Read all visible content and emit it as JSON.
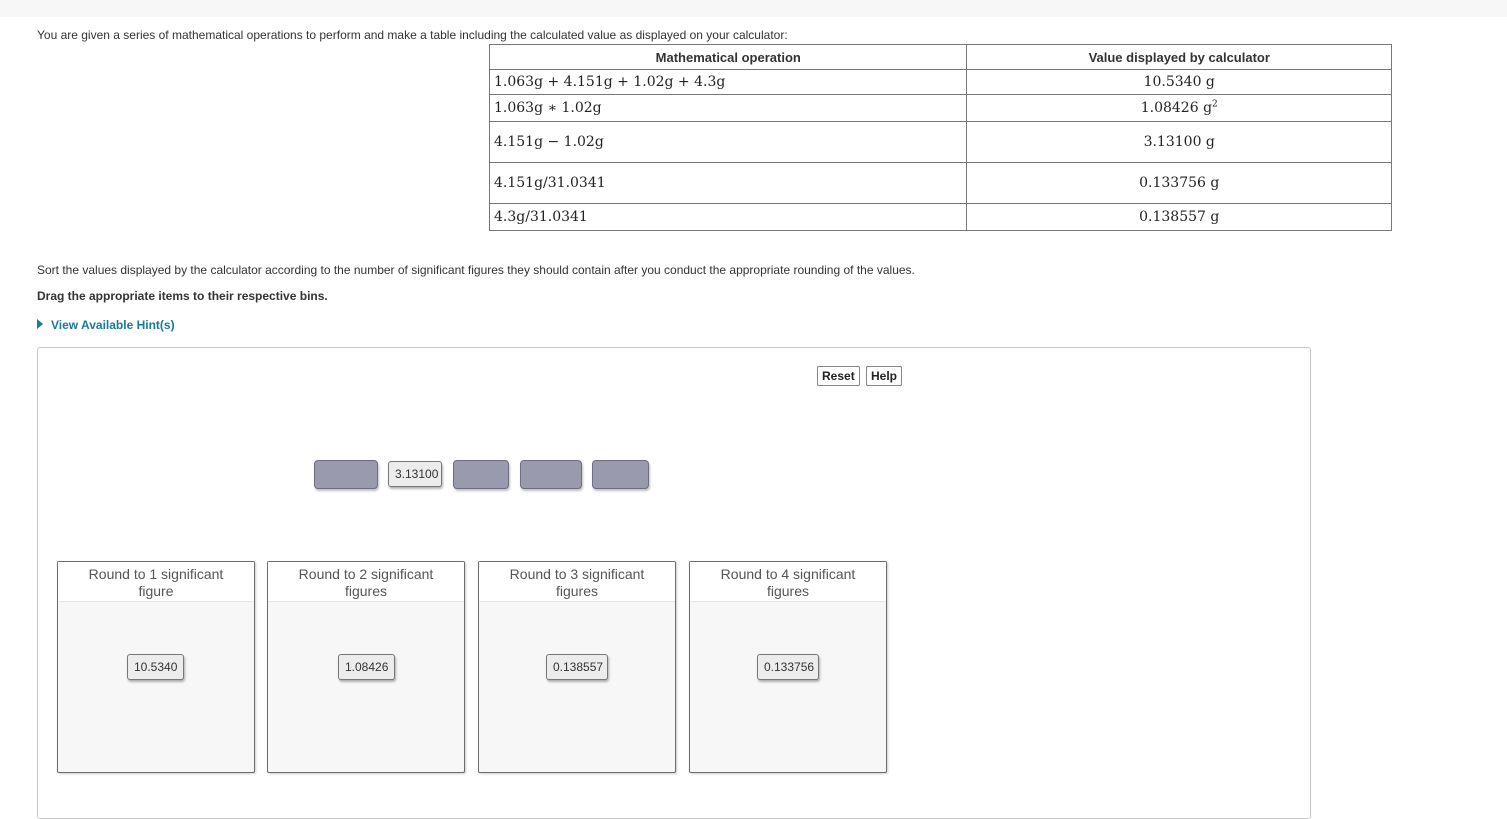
{
  "intro_text": "You are given a series of mathematical operations to perform and make a table including the calculated value as displayed on your calculator:",
  "table": {
    "headers": [
      "Mathematical operation",
      "Value displayed by calculator"
    ],
    "rows": [
      {
        "operation": "1.063g + 4.151g + 1.02g + 4.3g",
        "value": "10.5340 g"
      },
      {
        "operation": "1.063g ∗ 1.02g",
        "value": "1.08426 g",
        "value_sup": "2"
      },
      {
        "operation": "4.151g − 1.02g",
        "value": "3.13100 g"
      },
      {
        "operation": "4.151g/31.0341",
        "value": "0.133756 g"
      },
      {
        "operation": "4.3g/31.0341",
        "value": "0.138557 g"
      }
    ]
  },
  "sort_text": "Sort the values displayed by the calculator according to the number of significant figures they should contain after you conduct the appropriate rounding of the values.",
  "drag_text": "Drag the appropriate items to their respective bins.",
  "hint_label": "View Available Hint(s)",
  "buttons": {
    "reset": "Reset",
    "help": "Help"
  },
  "pool_item": "3.13100",
  "bins": [
    {
      "title": "Round to 1 significant figure",
      "item": "10.5340"
    },
    {
      "title": "Round to 2 significant figures",
      "item": "1.08426"
    },
    {
      "title": "Round to 3 significant figures",
      "item": "0.138557"
    },
    {
      "title": "Round to 4 significant figures",
      "item": "0.133756"
    }
  ],
  "colors": {
    "hint": "#1a7a99",
    "slot": "#9a9aae"
  }
}
